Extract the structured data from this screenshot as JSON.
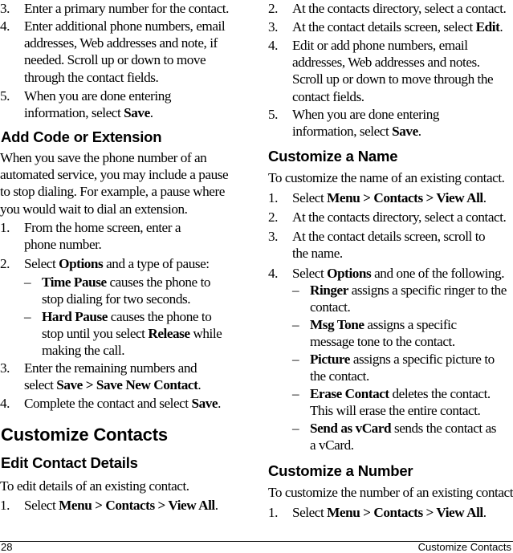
{
  "page": {
    "number": "28",
    "running_title": "Customize Contacts"
  },
  "left": {
    "top_steps": [
      {
        "num": "3.",
        "parts": [
          {
            "t": "Enter a primary number for the contact."
          }
        ]
      },
      {
        "num": "4.",
        "parts": [
          {
            "t": "Enter additional phone numbers, email addresses, Web addresses and note, if needed. Scroll up or down to move through the contact fields."
          }
        ]
      },
      {
        "num": "5.",
        "parts": [
          {
            "t": "When you are done entering information, select "
          },
          {
            "t": "Save",
            "b": true
          },
          {
            "t": "."
          }
        ]
      }
    ],
    "add_code": {
      "heading": "Add Code or Extension",
      "intro": "When you save the phone number of an automated service, you may include a pause to stop dialing. For example, a pause where you would wait to dial an extension.",
      "steps": [
        {
          "num": "1.",
          "parts": [
            {
              "t": "From the home screen, enter a phone number."
            }
          ]
        },
        {
          "num": "2.",
          "parts": [
            {
              "t": "Select "
            },
            {
              "t": "Options",
              "b": true
            },
            {
              "t": " and a type of pause:"
            }
          ]
        }
      ],
      "bullets": [
        {
          "parts": [
            {
              "t": "Time Pause",
              "b": true
            },
            {
              "t": " causes the phone to stop dialing for two seconds."
            }
          ]
        },
        {
          "parts": [
            {
              "t": "Hard Pause",
              "b": true
            },
            {
              "t": " causes the phone to stop until you select "
            },
            {
              "t": "Release",
              "b": true
            },
            {
              "t": " while making the call."
            }
          ]
        }
      ],
      "steps_after": [
        {
          "num": "3.",
          "parts": [
            {
              "t": "Enter the remaining numbers and select "
            },
            {
              "t": "Save > Save New Contact",
              "b": true
            },
            {
              "t": "."
            }
          ]
        },
        {
          "num": "4.",
          "parts": [
            {
              "t": "Complete the contact and select "
            },
            {
              "t": "Save",
              "b": true
            },
            {
              "t": "."
            }
          ]
        }
      ]
    },
    "customize_contacts": {
      "heading": "Customize Contacts",
      "edit_details": {
        "heading": "Edit Contact Details",
        "intro": "To edit details of an existing contact.",
        "steps": [
          {
            "num": "1.",
            "parts": [
              {
                "t": "Select "
              },
              {
                "t": "Menu > Contacts > View All",
                "b": true
              },
              {
                "t": "."
              }
            ]
          }
        ]
      }
    }
  },
  "right": {
    "edit_steps_cont": [
      {
        "num": "2.",
        "parts": [
          {
            "t": "At the contacts directory, select a contact."
          }
        ]
      },
      {
        "num": "3.",
        "parts": [
          {
            "t": "At the contact details screen, select "
          },
          {
            "t": "Edit",
            "b": true
          },
          {
            "t": "."
          }
        ]
      },
      {
        "num": "4.",
        "parts": [
          {
            "t": "Edit or add phone numbers, email addresses, Web addresses and notes. Scroll up or down to move through the contact fields."
          }
        ]
      },
      {
        "num": "5.",
        "parts": [
          {
            "t": "When you are done entering information, select "
          },
          {
            "t": "Save",
            "b": true
          },
          {
            "t": "."
          }
        ]
      }
    ],
    "customize_name": {
      "heading": "Customize a Name",
      "intro": "To customize the name of an existing contact.",
      "steps": [
        {
          "num": "1.",
          "parts": [
            {
              "t": "Select "
            },
            {
              "t": "Menu > Contacts > View All",
              "b": true
            },
            {
              "t": "."
            }
          ]
        },
        {
          "num": "2.",
          "parts": [
            {
              "t": "At the contacts directory, select a contact."
            }
          ]
        },
        {
          "num": "3.",
          "parts": [
            {
              "t": "At the contact details screen, scroll to the name."
            }
          ]
        },
        {
          "num": "4.",
          "parts": [
            {
              "t": "Select "
            },
            {
              "t": "Options",
              "b": true
            },
            {
              "t": " and one of the following."
            }
          ]
        }
      ],
      "bullets": [
        {
          "parts": [
            {
              "t": "Ringer",
              "b": true
            },
            {
              "t": " assigns a specific ringer to the contact."
            }
          ]
        },
        {
          "parts": [
            {
              "t": "Msg Tone",
              "b": true
            },
            {
              "t": " assigns a specific message tone to the contact."
            }
          ]
        },
        {
          "parts": [
            {
              "t": "Picture",
              "b": true
            },
            {
              "t": " assigns a specific picture to the contact."
            }
          ]
        },
        {
          "parts": [
            {
              "t": "Erase Contact",
              "b": true
            },
            {
              "t": " deletes the contact. This will erase the entire contact."
            }
          ]
        },
        {
          "parts": [
            {
              "t": "Send as vCard",
              "b": true
            },
            {
              "t": " sends the contact as a vCard."
            }
          ]
        }
      ]
    },
    "customize_number": {
      "heading": "Customize a Number",
      "intro": "To customize the number of an existing contact.",
      "steps": [
        {
          "num": "1.",
          "parts": [
            {
              "t": "Select "
            },
            {
              "t": "Menu > Contacts > View All",
              "b": true
            },
            {
              "t": "."
            }
          ]
        }
      ]
    }
  },
  "bullet_glyph": "–"
}
